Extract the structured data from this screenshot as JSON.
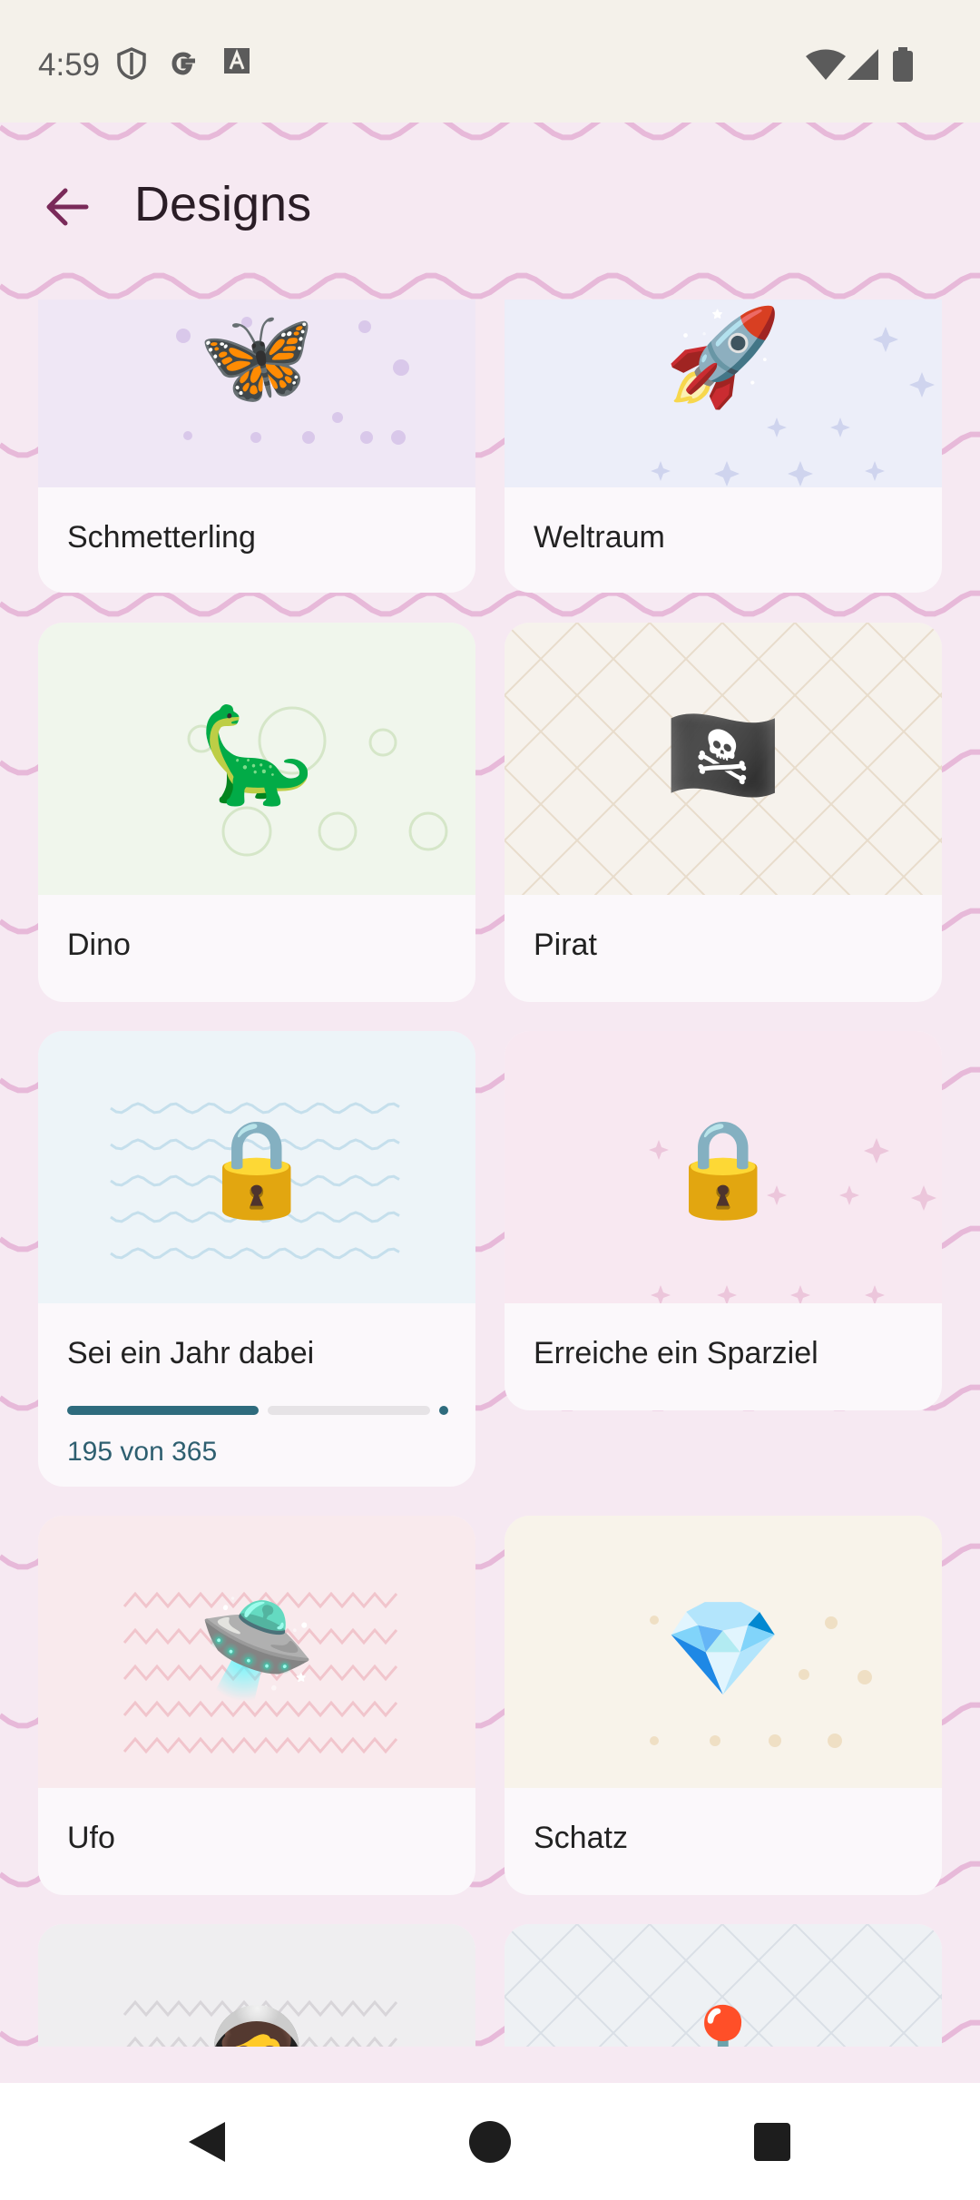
{
  "status_bar": {
    "time": "4:59",
    "left_icons": [
      "shield-icon",
      "google-icon",
      "font-icon"
    ],
    "right_icons": [
      "wifi-icon",
      "signal-icon",
      "battery-icon"
    ]
  },
  "app_bar": {
    "back_icon": "arrow-back-icon",
    "title": "Designs"
  },
  "designs": [
    {
      "label": "Schmetterling",
      "emoji": "🦋",
      "art_bg": "#efe7f5",
      "locked": false
    },
    {
      "label": "Weltraum",
      "emoji": "🚀",
      "art_bg": "#eceef9",
      "locked": false
    },
    {
      "label": "Dino",
      "emoji": "🦕",
      "art_bg": "#f0f6ec",
      "locked": false
    },
    {
      "label": "Pirat",
      "emoji": "🏴‍☠️",
      "art_bg": "#f6f2ec",
      "locked": false
    },
    {
      "label": "Sei ein Jahr dabei",
      "emoji": "🔒",
      "art_bg": "#edf4f8",
      "locked": true,
      "progress": {
        "text": "195 von 365",
        "current": 195,
        "total": 365
      }
    },
    {
      "label": "Erreiche ein Sparziel",
      "emoji": "🔒",
      "art_bg": "#f8e8f1",
      "locked": true
    },
    {
      "label": "Ufo",
      "emoji": "🛸",
      "art_bg": "#f9eaed",
      "locked": false
    },
    {
      "label": "Schatz",
      "emoji": "💎",
      "art_bg": "#f8f3ea",
      "locked": false
    },
    {
      "label": "",
      "emoji": "🧑‍🚀",
      "art_bg": "#efeef0",
      "locked": false
    },
    {
      "label": "",
      "emoji": "🕹️",
      "art_bg": "#eef1f4",
      "locked": false
    }
  ],
  "colors": {
    "background": "#f6e9f2",
    "wave": "#e7b9d9",
    "accent": "#7a2a5a",
    "progress": "#2e6b7d"
  },
  "nav_bar": {
    "icons": [
      "back-triangle-icon",
      "home-circle-icon",
      "recents-square-icon"
    ]
  }
}
